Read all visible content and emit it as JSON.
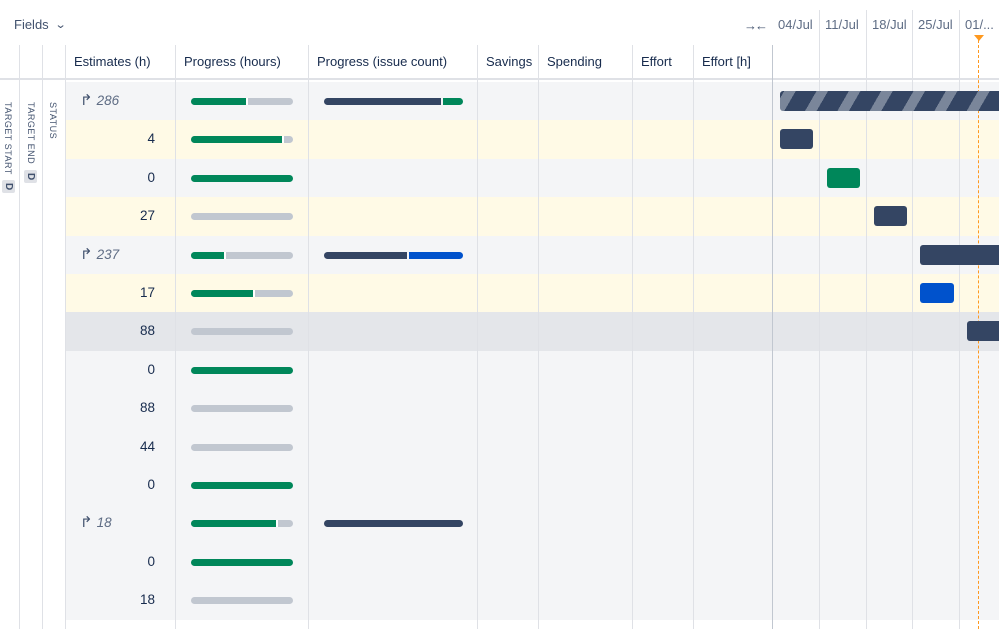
{
  "toolbar": {
    "fields_label": "Fields",
    "fields_icon": "chevron-down-icon",
    "collapse_icon": "collapse-arrows-icon"
  },
  "columns": {
    "estimates": "Estimates (h)",
    "progress_hours": "Progress (hours)",
    "progress_issue_count": "Progress (issue count)",
    "savings": "Savings",
    "spending": "Spending",
    "effort": "Effort",
    "effort_h": "Effort [h]"
  },
  "side_columns": {
    "target_start": "TARGET START",
    "target_start_badge": "D",
    "target_end": "TARGET END",
    "target_end_badge": "D",
    "status": "STATUS"
  },
  "timeline": {
    "dates": [
      "04/Jul",
      "11/Jul",
      "18/Jul",
      "25/Jul",
      "01/..."
    ],
    "today_color": "#ff991f"
  },
  "colors": {
    "done_green": "#00875a",
    "todo_gray": "#c1c7d0",
    "dark_navy": "#344563",
    "blue": "#0052cc",
    "row_yellow": "#fffae6",
    "row_gray": "#f4f5f7"
  },
  "rows": [
    {
      "estimate": "286",
      "parent": true,
      "progress_hours": 0.55,
      "issue_done": 0.84,
      "issue_second_color": "green",
      "gantt": "striped"
    },
    {
      "estimate": "4",
      "parent": false,
      "progress_hours": 0.9,
      "gantt": "dark"
    },
    {
      "estimate": "0",
      "parent": false,
      "progress_hours": 1.0,
      "gantt": "green"
    },
    {
      "estimate": "27",
      "parent": false,
      "progress_hours": 0.0,
      "gantt": "dark"
    },
    {
      "estimate": "237",
      "parent": true,
      "progress_hours": 0.33,
      "issue_done": 0.6,
      "issue_second_color": "blue",
      "gantt": "dark"
    },
    {
      "estimate": "17",
      "parent": false,
      "progress_hours": 0.62,
      "gantt": "blue"
    },
    {
      "estimate": "88",
      "parent": false,
      "progress_hours": 0.0,
      "gantt": "dark"
    },
    {
      "estimate": "0",
      "parent": false,
      "progress_hours": 1.0
    },
    {
      "estimate": "88",
      "parent": false,
      "progress_hours": 0.0
    },
    {
      "estimate": "44",
      "parent": false,
      "progress_hours": 0.0
    },
    {
      "estimate": "0",
      "parent": false,
      "progress_hours": 1.0
    },
    {
      "estimate": "18",
      "parent": true,
      "progress_hours": 0.84,
      "issue_done": 1.0,
      "issue_second_color": "none"
    },
    {
      "estimate": "0",
      "parent": false,
      "progress_hours": 1.0
    },
    {
      "estimate": "18",
      "parent": false,
      "progress_hours": 0.0
    }
  ]
}
